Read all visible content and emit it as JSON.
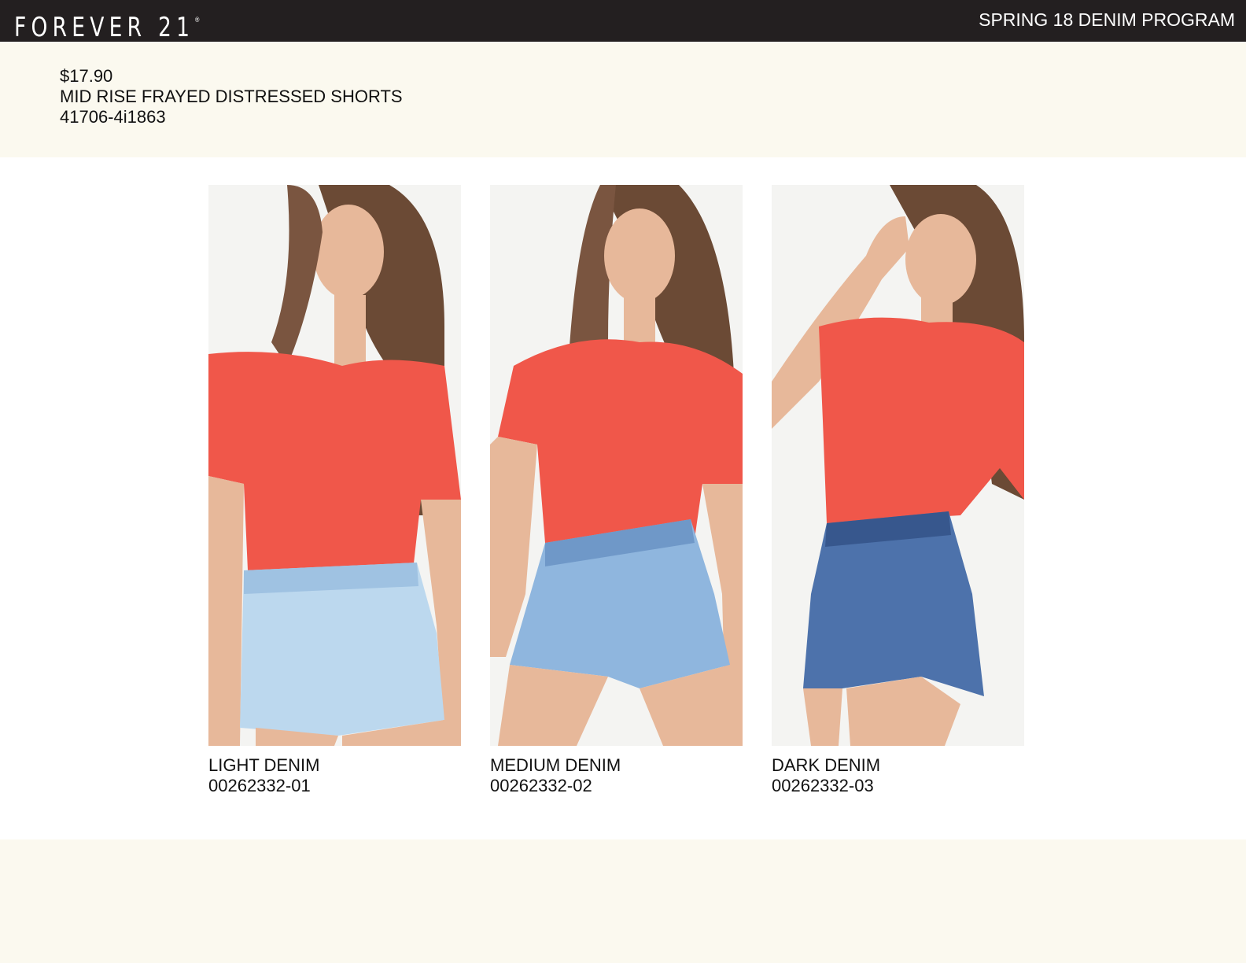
{
  "header": {
    "brand": "FOREVER 21",
    "brand_mark": "®",
    "program_title": "SPRING 18 DENIM PROGRAM"
  },
  "product": {
    "price": "$17.90",
    "name": "MID RISE FRAYED DISTRESSED SHORTS",
    "style_number": "41706-4i1863"
  },
  "variants": [
    {
      "wash": "LIGHT DENIM",
      "sku": "00262332-01",
      "denim_color": "#bcd8ee",
      "denim_shadow": "#9fc2e2",
      "top_color": "#f0574a"
    },
    {
      "wash": "MEDIUM DENIM",
      "sku": "00262332-02",
      "denim_color": "#8fb6de",
      "denim_shadow": "#6f98c8",
      "top_color": "#f0574a"
    },
    {
      "wash": "DARK DENIM",
      "sku": "00262332-03",
      "denim_color": "#4d72ab",
      "denim_shadow": "#37578d",
      "top_color": "#f0574a"
    }
  ],
  "colors": {
    "header_bg": "#231f20",
    "page_bg": "#fbf9ef",
    "panel_bg": "#ffffff"
  }
}
